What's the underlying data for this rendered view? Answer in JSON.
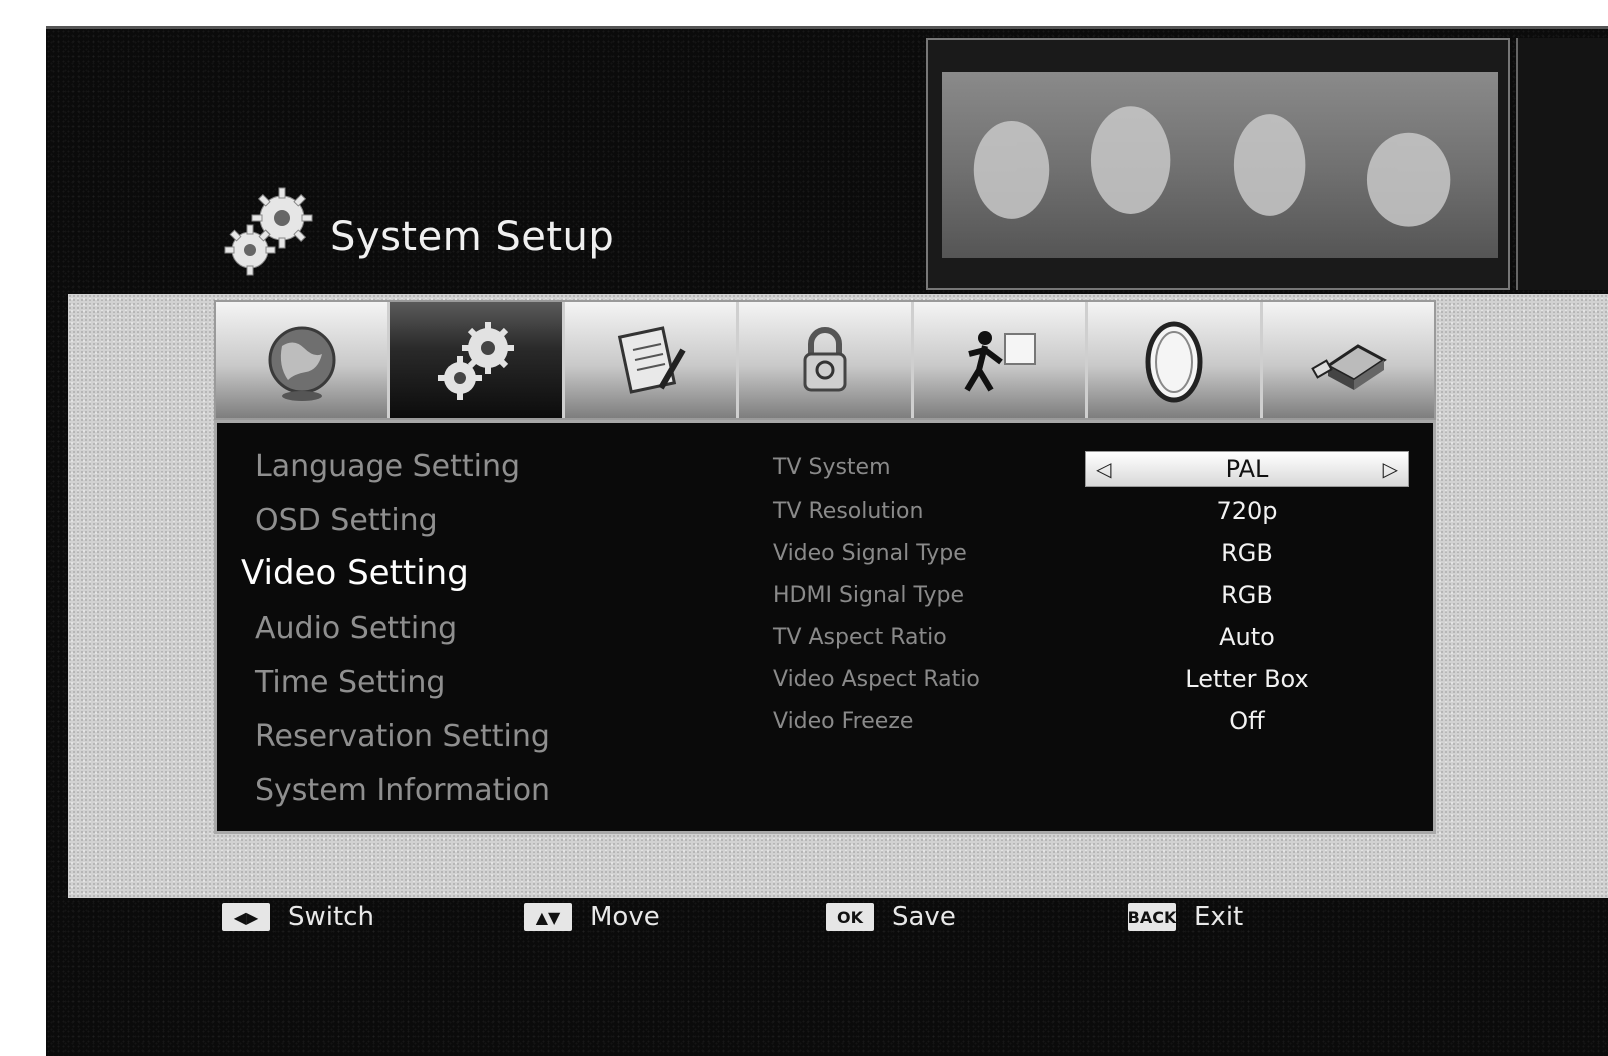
{
  "header": {
    "title": "System Setup"
  },
  "tabs": [
    {
      "icon": "globe-icon",
      "active": false
    },
    {
      "icon": "gears-icon",
      "active": true
    },
    {
      "icon": "notepad-pen-icon",
      "active": false
    },
    {
      "icon": "lock-icon",
      "active": false
    },
    {
      "icon": "figure-icon",
      "active": false
    },
    {
      "icon": "oval-disc-icon",
      "active": false
    },
    {
      "icon": "usb-printer-icon",
      "active": false
    }
  ],
  "menu": {
    "items": [
      {
        "label": "Language Setting",
        "active": false
      },
      {
        "label": "OSD Setting",
        "active": false
      },
      {
        "label": "Video Setting",
        "active": true
      },
      {
        "label": "Audio Setting",
        "active": false
      },
      {
        "label": "Time Setting",
        "active": false
      },
      {
        "label": "Reservation Setting",
        "active": false
      },
      {
        "label": "System Information",
        "active": false
      }
    ]
  },
  "settings": [
    {
      "label": "TV System",
      "value": "PAL",
      "selected": true
    },
    {
      "label": "TV Resolution",
      "value": "720p"
    },
    {
      "label": "Video Signal Type",
      "value": "RGB"
    },
    {
      "label": "HDMI Signal Type",
      "value": "RGB"
    },
    {
      "label": "TV Aspect Ratio",
      "value": "Auto"
    },
    {
      "label": "Video Aspect Ratio",
      "value": "Letter Box"
    },
    {
      "label": "Video Freeze",
      "value": "Off"
    }
  ],
  "footer": {
    "hints": [
      {
        "key": "◀▶",
        "label": "Switch"
      },
      {
        "key": "▲▼",
        "label": "Move"
      },
      {
        "key": "OK",
        "label": "Save"
      },
      {
        "key": "BACK",
        "label": "Exit"
      }
    ]
  }
}
